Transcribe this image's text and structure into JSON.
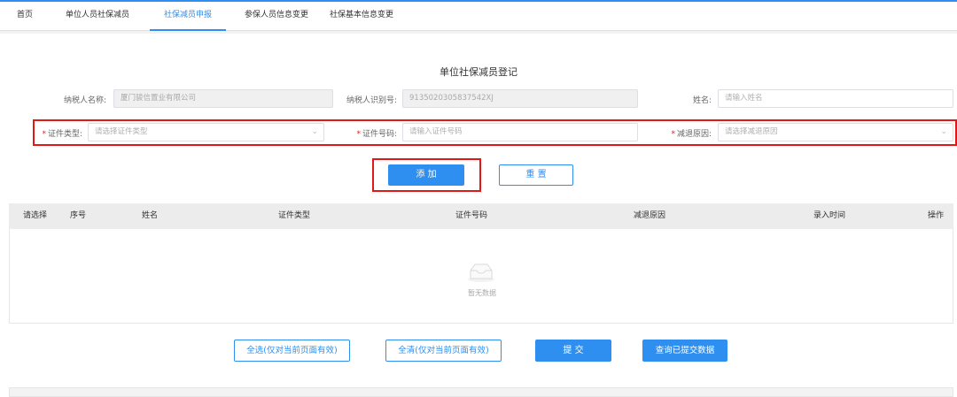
{
  "nav": {
    "tabs": [
      {
        "label": "首页"
      },
      {
        "label": "单位人员社保减员"
      },
      {
        "label": "社保减员申报"
      },
      {
        "label": "参保人员信息变更"
      },
      {
        "label": "社保基本信息变更"
      }
    ],
    "active_tab": "社保减员申报"
  },
  "form": {
    "title": "单位社保减员登记",
    "taxpayer_name": {
      "label": "纳税人名称:",
      "value": "厦门骏信置业有限公司"
    },
    "taxpayer_id": {
      "label": "纳税人识别号:",
      "value": "913502030583754​2XJ"
    },
    "person_name": {
      "label": "姓名:",
      "placeholder": "请输入姓名"
    },
    "id_type": {
      "required_mark": "*",
      "label": "证件类型:",
      "placeholder": "请选择证件类型"
    },
    "id_number": {
      "required_mark": "*",
      "label": "证件号码:",
      "placeholder": "请输入证件号码"
    },
    "reduce_reason": {
      "required_mark": "*",
      "label": "减退原因:",
      "placeholder": "请选择减退原因"
    },
    "add_label": "添 加",
    "reset_label": "重 置"
  },
  "table": {
    "columns": [
      "请选择",
      "序号",
      "姓名",
      "证件类型",
      "证件号码",
      "减退原因",
      "录入时间",
      "操作"
    ],
    "rows": [],
    "empty_text": "暂无数据"
  },
  "actions": {
    "select_all": "全选(仅对当前页面有效)",
    "clear_all": "全清(仅对当前页面有效)",
    "submit": "提 交",
    "query_submitted": "查询已提交数据"
  },
  "colors": {
    "accent": "#2f8ff0",
    "highlight_box": "#e01818",
    "required": "#e02020"
  }
}
